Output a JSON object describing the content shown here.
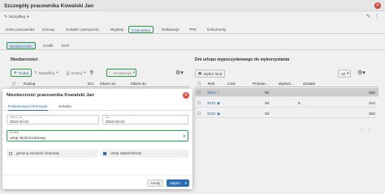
{
  "window": {
    "title": "Szczegóły pracownika Kowalski Jan",
    "close_icon": "close-icon"
  },
  "toolbar": {
    "modify_label": "Modyfikuj"
  },
  "tabs": [
    {
      "label": "Dane pracownika"
    },
    {
      "label": "Umowy"
    },
    {
      "label": "Dodatki i potrącenia"
    },
    {
      "label": "Wypłaty"
    },
    {
      "label": "Czas pracy",
      "active": true
    },
    {
      "label": "Deklaracje"
    },
    {
      "label": "PPK"
    },
    {
      "label": "Dokumenty"
    }
  ],
  "subtabs": [
    {
      "label": "Nieobecności",
      "active": true
    },
    {
      "label": "Grafik"
    },
    {
      "label": "ECP"
    }
  ],
  "left_panel": {
    "heading": "Nieobecności",
    "add_label": "Dodaj",
    "modify_label": "Modyfikuj",
    "print_label": "Drukuj",
    "accept_label": "Akceptacja",
    "columns": [
      "Rodzaj",
      "Dni",
      "Okres od",
      "Okres do"
    ]
  },
  "right_panel": {
    "heading": "Dni urlopu wypoczynkowego do wykorzystania",
    "calc_label": "Wylicz limit",
    "page_size": "10",
    "columns": [
      "Rok",
      "Limit",
      "Przenie...",
      "Wykorz...",
      "Zostało"
    ],
    "rows": [
      {
        "year": "2024",
        "limit": "",
        "przen": "0d",
        "wyk": "",
        "zost": "26d",
        "selected": true
      },
      {
        "year": "2023",
        "limit": "",
        "przen": "0d",
        "wyk": "5",
        "zost": "21d",
        "selected": false
      },
      {
        "year": "2022",
        "limit": "",
        "przen": "0d",
        "wyk": "",
        "zost": "26d",
        "selected": false
      }
    ]
  },
  "modal": {
    "title": "Nieobecność pracownika Kowalski Jan",
    "tabs": [
      {
        "label": "Podstawowe informacje",
        "active": true
      },
      {
        "label": "Notatka"
      }
    ],
    "from": {
      "label": "Okres od",
      "value": "2024-10-21"
    },
    "to": {
      "label": "Do",
      "value": "2024-10-21"
    },
    "type": {
      "label": "Rodzaj",
      "value": "urlop okolicznościowy"
    },
    "chk1": {
      "label": "generuj wniosek urlopowy",
      "checked": false
    },
    "chk2": {
      "label": "urlop zatwierdzony",
      "checked": true
    },
    "cancel": "Anuluj",
    "save": "Zapisz"
  }
}
